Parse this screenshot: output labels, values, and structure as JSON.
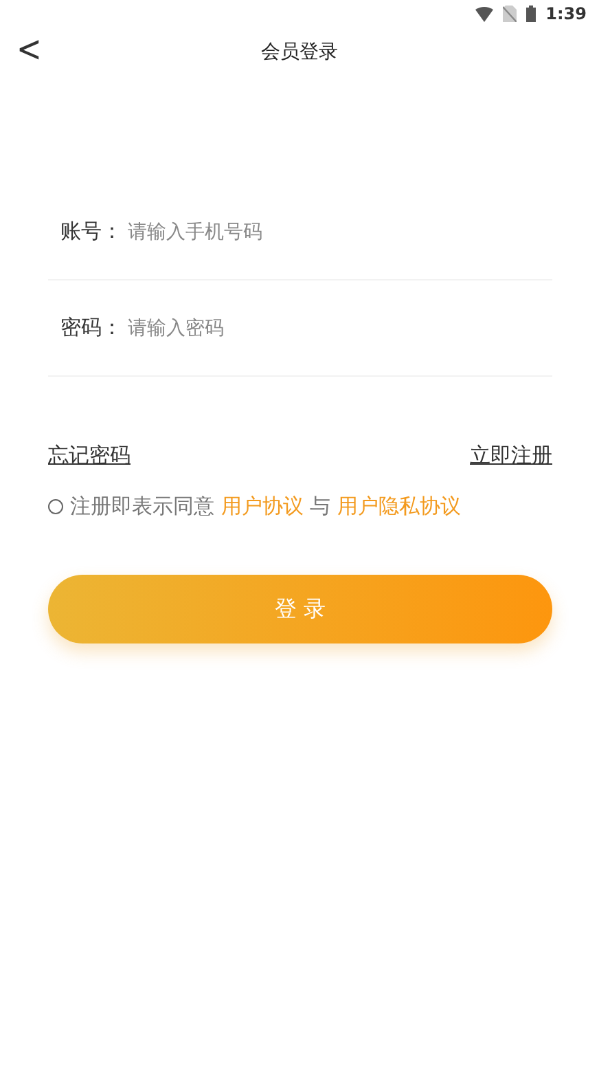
{
  "status_bar": {
    "time": "1:39"
  },
  "header": {
    "back": "<",
    "title": "会员登录"
  },
  "fields": [
    {
      "label": "账号：",
      "placeholder": "请输入手机号码"
    },
    {
      "label": "密码：",
      "placeholder": "请输入密码"
    }
  ],
  "links": {
    "forgot": "忘记密码",
    "register": "立即注册"
  },
  "agreement": {
    "checked": false,
    "prefix": "注册即表示同意",
    "link_1": "用户协议",
    "conjunction": "与",
    "link_2": "用户隐私协议"
  },
  "login_button": "登 录"
}
